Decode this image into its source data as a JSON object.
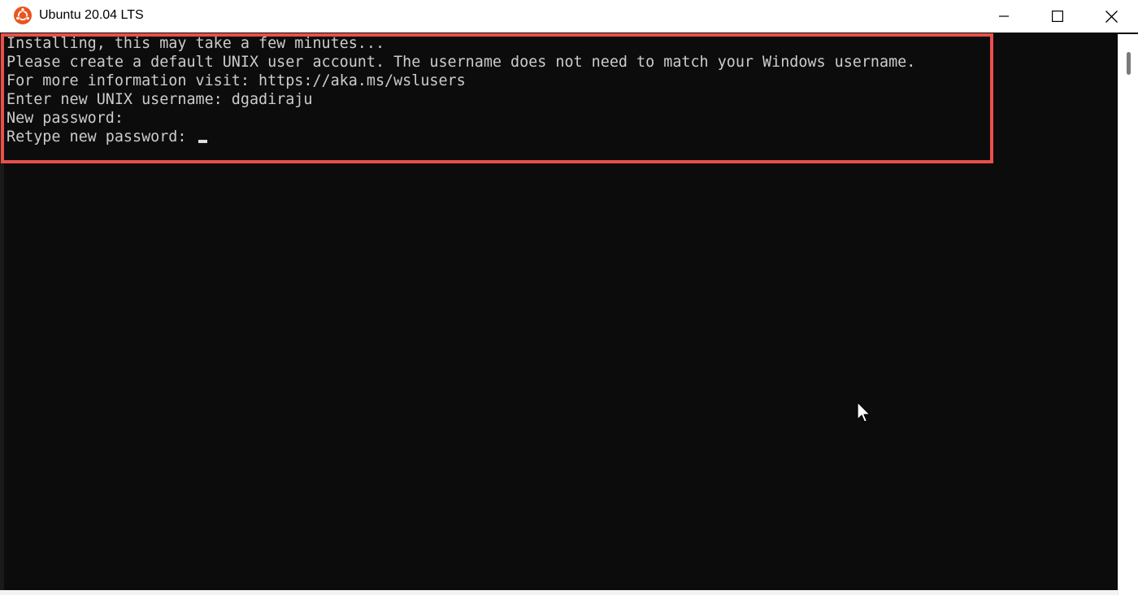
{
  "window": {
    "title": "Ubuntu 20.04 LTS",
    "app_icon": "ubuntu-logo-icon",
    "controls": [
      "minimize-icon",
      "maximize-icon",
      "close-icon"
    ]
  },
  "terminal": {
    "lines": [
      "Installing, this may take a few minutes...",
      "Please create a default UNIX user account. The username does not need to match your Windows username.",
      "For more information visit: https://aka.ms/wslusers",
      "Enter new UNIX username: dgadiraju",
      "New password:",
      "Retype new password: "
    ],
    "cursor_visible": true
  },
  "colors": {
    "terminal_background": "#0c0c0c",
    "terminal_text": "#cccccc",
    "highlight_border": "#e8504a",
    "ubuntu_orange": "#e95420"
  }
}
